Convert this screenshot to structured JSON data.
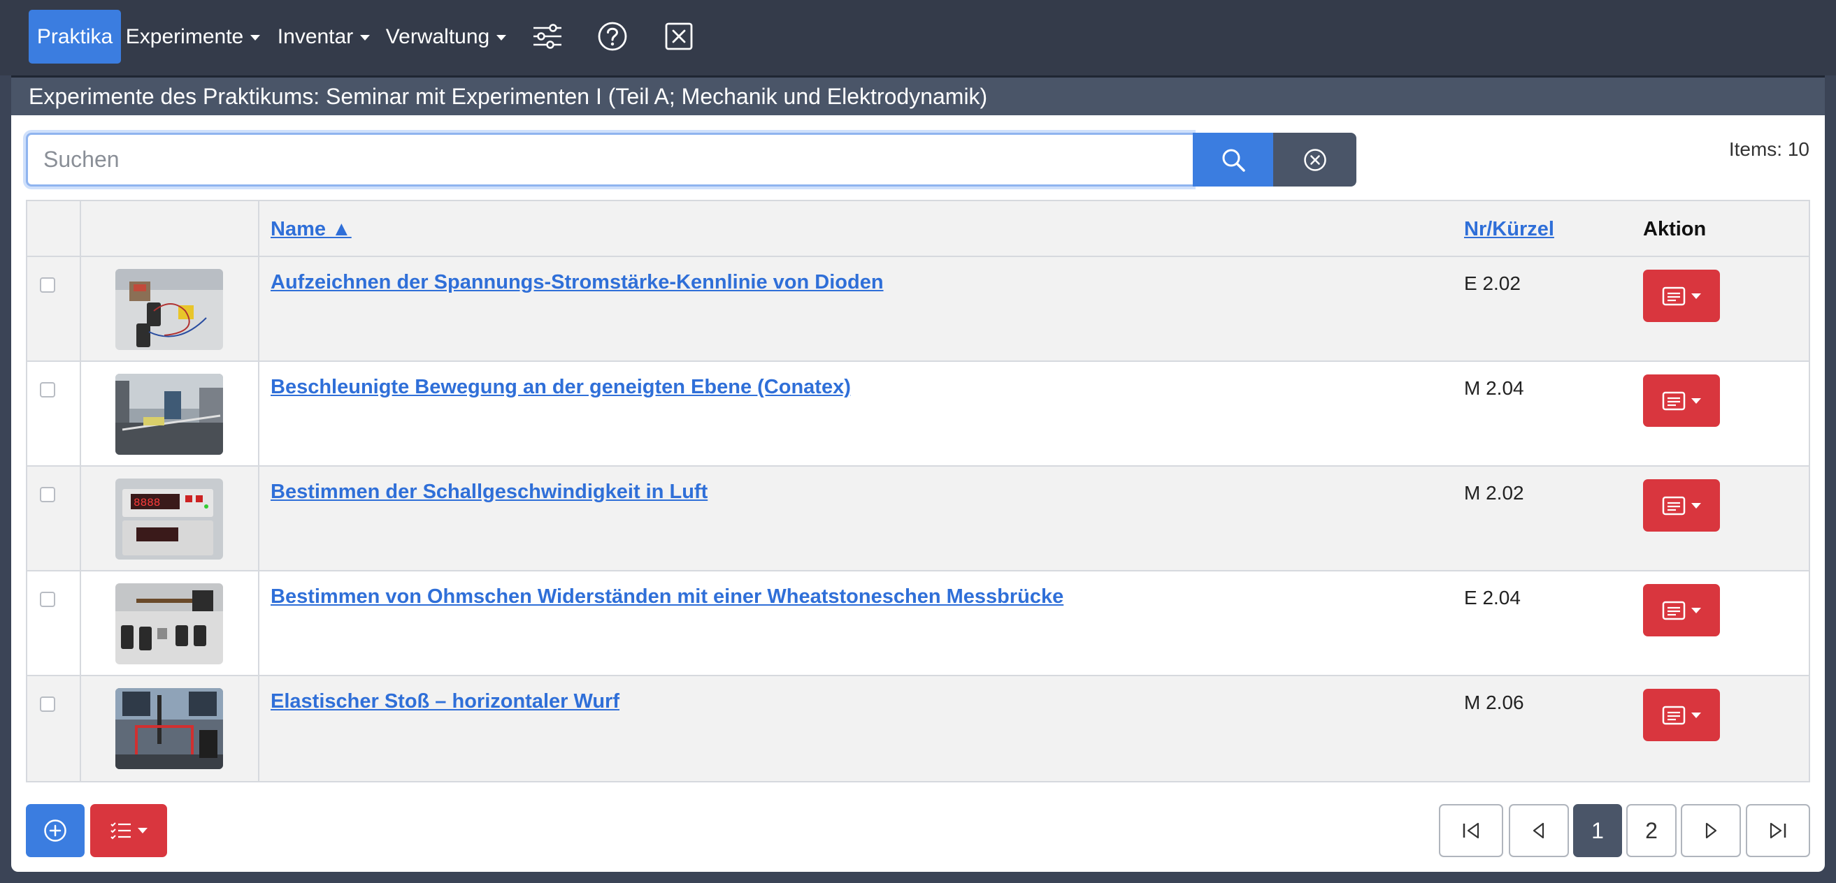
{
  "navbar": {
    "items": [
      {
        "label": "Praktika"
      },
      {
        "label": "Experimente"
      },
      {
        "label": "Inventar"
      },
      {
        "label": "Verwaltung"
      }
    ]
  },
  "header": {
    "title": "Experimente des Praktikums: Seminar mit Experimenten I (Teil A; Mechanik und Elektrodynamik)"
  },
  "search": {
    "placeholder": "Suchen",
    "value": ""
  },
  "items_count": "Items: 10",
  "table": {
    "columns": {
      "name": "Name ▲",
      "code": "Nr/Kürzel",
      "action": "Aktion"
    },
    "rows": [
      {
        "name": "Aufzeichnen der Spannungs-Stromstärke-Kennlinie von Dioden",
        "code": "E 2.02"
      },
      {
        "name": "Beschleunigte Bewegung an der geneigten Ebene (Conatex)",
        "code": "M 2.04"
      },
      {
        "name": "Bestimmen der Schallgeschwindigkeit in Luft",
        "code": "M 2.02"
      },
      {
        "name": "Bestimmen von Ohmschen Widerständen mit einer Wheatstoneschen Messbrücke",
        "code": "E 2.04"
      },
      {
        "name": "Elastischer Stoß – horizontaler Wurf",
        "code": "M 2.06"
      }
    ]
  },
  "pagination": {
    "pages": [
      "1",
      "2"
    ],
    "current": "1"
  },
  "colors": {
    "primary": "#3b7de0",
    "danger": "#d9363e",
    "navbar": "#343b4a",
    "secondary": "#4a5568",
    "link": "#2f6fd8"
  }
}
